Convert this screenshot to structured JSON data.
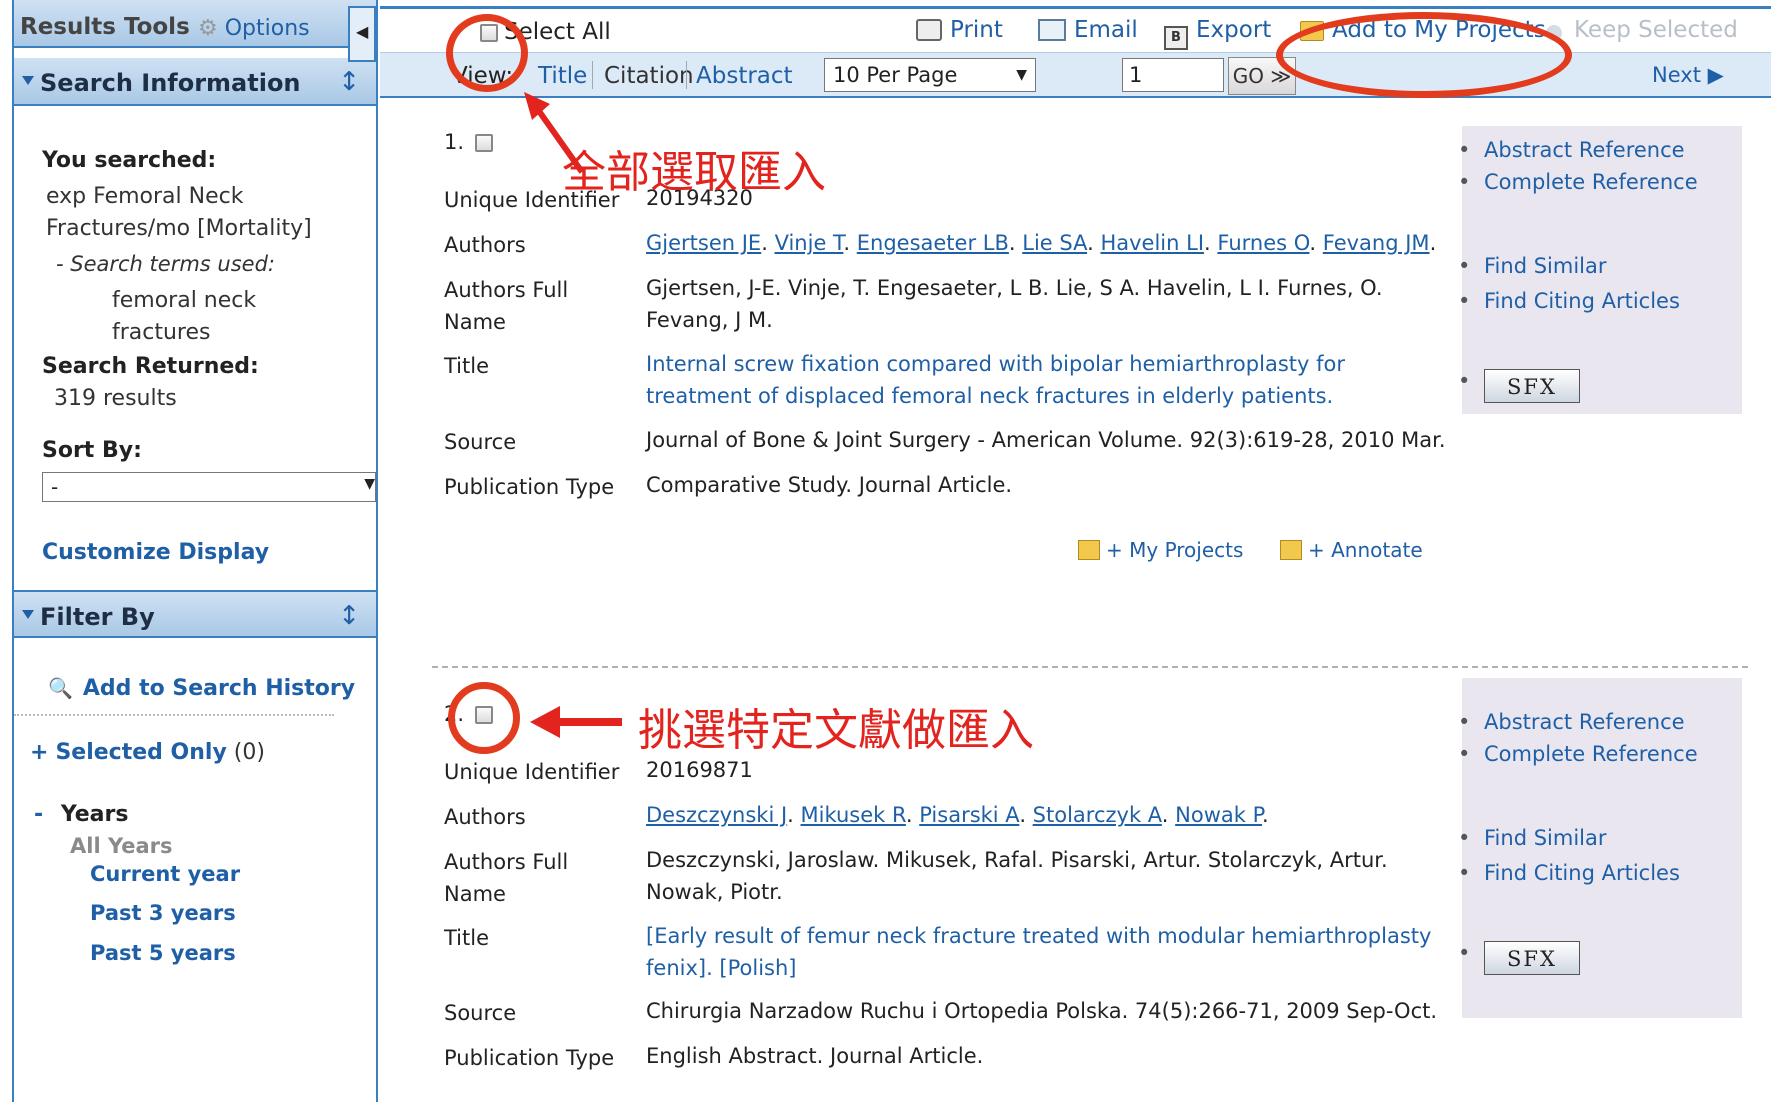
{
  "left": {
    "results_tools": "Results Tools",
    "options": "Options",
    "search_info_title": "Search Information",
    "you_searched_label": "You searched:",
    "query_line1": "exp Femoral Neck",
    "query_line2": "Fractures/mo [Mortality]",
    "terms_used_label": "- Search terms used:",
    "term_line1": "femoral neck",
    "term_line2": "fractures",
    "search_returned_label": "Search Returned:",
    "results_count": "319 results",
    "sort_by_label": "Sort By:",
    "sort_value": "-",
    "customize_display": "Customize Display",
    "filter_by_title": "Filter By",
    "add_search_history": "Add to Search History",
    "selected_only_prefix": "+",
    "selected_only": "Selected Only",
    "selected_count": "(0)",
    "years_prefix": "-",
    "years": "Years",
    "all_years": "All Years",
    "current_year": "Current year",
    "past_3": "Past 3 years",
    "past_5": "Past 5 years"
  },
  "toolbar": {
    "select_all": "Select All",
    "print": "Print",
    "email": "Email",
    "export": "Export",
    "add_projects": "Add to My Projects",
    "keep_selected": "Keep Selected",
    "view_label": "View:",
    "view_title": "Title",
    "view_citation": "Citation",
    "view_abstract": "Abstract",
    "per_page": "10 Per Page",
    "page_input": "1",
    "go": "GO ≫",
    "next": "Next ▶"
  },
  "field_labels": {
    "uid": "Unique Identifier",
    "authors": "Authors",
    "authors_full_1": "Authors Full",
    "authors_full_2": "Name",
    "title": "Title",
    "source": "Source",
    "pubtype": "Publication Type"
  },
  "sidebar_links": {
    "abstract_ref": "Abstract Reference",
    "complete_ref": "Complete Reference",
    "find_similar": "Find Similar",
    "find_citing": "Find Citing Articles",
    "sfx": "SFX"
  },
  "records": [
    {
      "num": "1.",
      "uid": "20194320",
      "authors": [
        "Gjertsen JE",
        "Vinje T",
        "Engesaeter LB",
        "Lie SA",
        "Havelin LI",
        "Furnes O",
        "Fevang JM"
      ],
      "authors_full_1": "Gjertsen, J-E. Vinje, T. Engesaeter, L B. Lie, S A. Havelin, L I. Furnes, O.",
      "authors_full_2": "Fevang, J M.",
      "title_1": "Internal screw fixation compared with bipolar hemiarthroplasty for",
      "title_2": "treatment of displaced femoral neck fractures in elderly patients.",
      "source": "Journal of Bone & Joint Surgery - American Volume. 92(3):619-28, 2010 Mar.",
      "pubtype": "Comparative Study. Journal Article.",
      "my_projects": "+ My Projects",
      "annotate": "+ Annotate"
    },
    {
      "num": "2.",
      "uid": "20169871",
      "authors": [
        "Deszczynski J",
        "Mikusek R",
        "Pisarski A",
        "Stolarczyk A",
        "Nowak P"
      ],
      "authors_full_1": "Deszczynski, Jaroslaw. Mikusek, Rafal. Pisarski, Artur. Stolarczyk, Artur.",
      "authors_full_2": "Nowak, Piotr.",
      "title_1": "[Early result of femur neck fracture treated with modular hemiarthroplasty",
      "title_2": "fenix]. [Polish]",
      "source": "Chirurgia Narzadow Ruchu i Ortopedia Polska. 74(5):266-71, 2009 Sep-Oct.",
      "pubtype": "English Abstract. Journal Article."
    }
  ],
  "annotations": {
    "select_all_note": "全部選取匯入",
    "select_specific_note": "挑選特定文獻做匯入"
  },
  "colors": {
    "accent": "#3a7fc0",
    "link": "#1f5fa6",
    "annotation": "#e2231e"
  }
}
